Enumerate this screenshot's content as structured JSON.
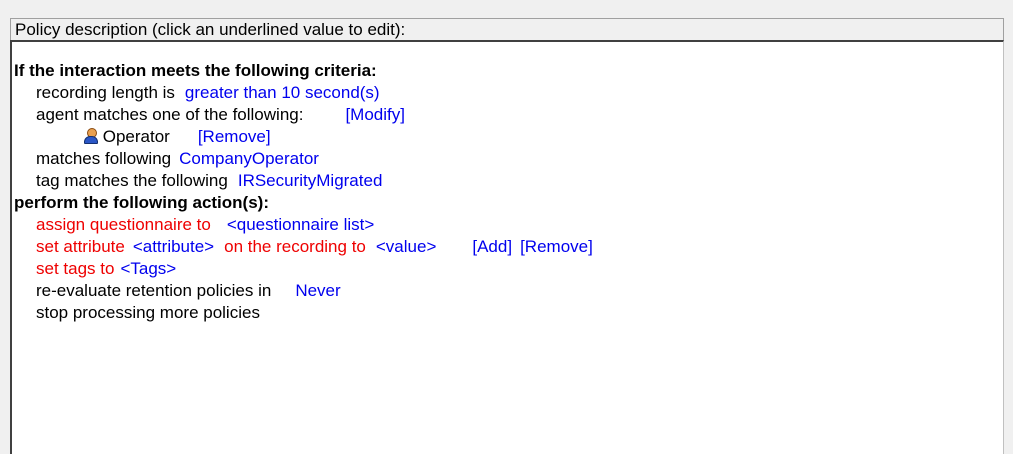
{
  "header": {
    "title": "Policy description (click an underlined value to edit):"
  },
  "criteria": {
    "heading": "If the interaction meets the following criteria:",
    "recording_length_label": "recording length is",
    "recording_length_value": "greater than 10 second(s)",
    "agent_label": "agent matches one of the following:",
    "agent_modify": "[Modify]",
    "agent_item_name": "Operator",
    "agent_item_remove": "[Remove]",
    "matches_label": "matches following",
    "matches_value": "CompanyOperator",
    "tag_label": "tag matches the following",
    "tag_value": "IRSecurityMigrated"
  },
  "actions": {
    "heading": "perform the following action(s):",
    "assign_label": "assign questionnaire to",
    "assign_value": "<questionnaire list>",
    "attr_label": "set attribute",
    "attr_value": "<attribute>",
    "attr_mid": "on the recording to",
    "attr_target": "<value>",
    "attr_add": "[Add]",
    "attr_remove": "[Remove]",
    "tags_label": "set tags to",
    "tags_value": "<Tags>",
    "reeval_label": "re-evaluate retention policies in",
    "reeval_value": "Never",
    "stop_label": "stop processing more policies"
  },
  "icons": {
    "agent_item_icon": "user-icon"
  },
  "colors": {
    "link": "#0000ee",
    "required": "#ee0000"
  }
}
